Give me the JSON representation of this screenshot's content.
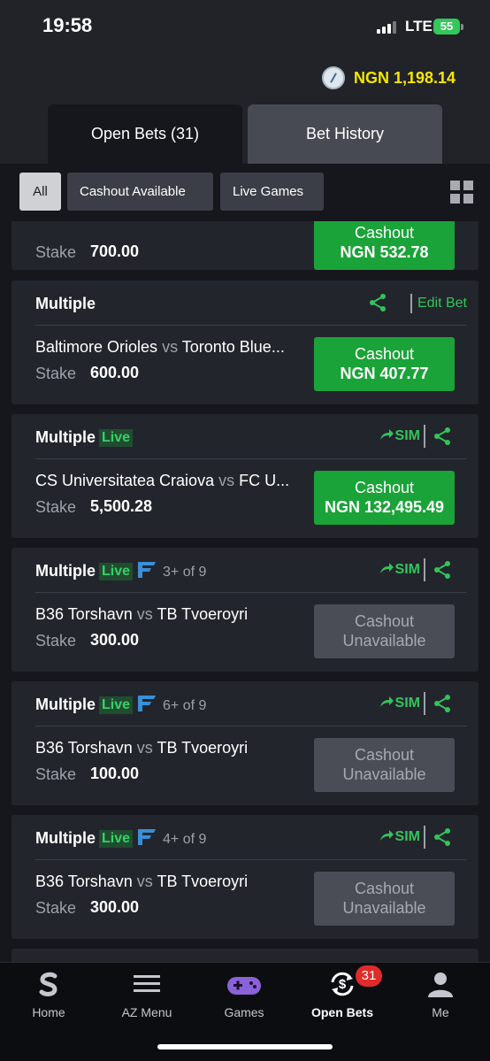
{
  "status_bar": {
    "time": "19:58",
    "network": "LTE",
    "battery": "55"
  },
  "header": {
    "balance": "NGN 1,198.14"
  },
  "tabs": [
    {
      "label": "Open Bets (31)"
    },
    {
      "label": "Bet History"
    }
  ],
  "filters": [
    {
      "label": "All"
    },
    {
      "label": "Cashout Available"
    },
    {
      "label": "Live Games"
    }
  ],
  "labels": {
    "stake": "Stake",
    "vs": "vs",
    "live": "Live",
    "sim": "SIM",
    "edit_bet": "Edit Bet",
    "cashout": "Cashout",
    "unavailable": "Unavailable"
  },
  "cards": [
    {
      "stake": "700.00",
      "cashout_amount": "NGN 532.78"
    },
    {
      "title": "Multiple",
      "home": "Baltimore Orioles",
      "away": "Toronto Blue...",
      "stake": "600.00",
      "cashout_amount": "NGN 407.77"
    },
    {
      "title": "Multiple",
      "home": "CS Universitatea Craiova",
      "away": "FC U...",
      "stake": "5,500.28",
      "cashout_amount": "NGN 132,495.49"
    },
    {
      "title": "Multiple",
      "legs": "3+ of 9",
      "home": "B36 Torshavn",
      "away": "TB Tvoeroyri",
      "stake": "300.00"
    },
    {
      "title": "Multiple",
      "legs": "6+ of 9",
      "home": "B36 Torshavn",
      "away": "TB Tvoeroyri",
      "stake": "100.00"
    },
    {
      "title": "Multiple",
      "legs": "4+ of 9",
      "home": "B36 Torshavn",
      "away": "TB Tvoeroyri",
      "stake": "300.00"
    }
  ],
  "nav": [
    {
      "label": "Home"
    },
    {
      "label": "AZ Menu"
    },
    {
      "label": "Games"
    },
    {
      "label": "Open Bets",
      "badge": "31"
    },
    {
      "label": "Me"
    }
  ],
  "colors": {
    "accent_green": "#1aa338",
    "balance_yellow": "#f7e600",
    "badge_red": "#e02b2b"
  }
}
